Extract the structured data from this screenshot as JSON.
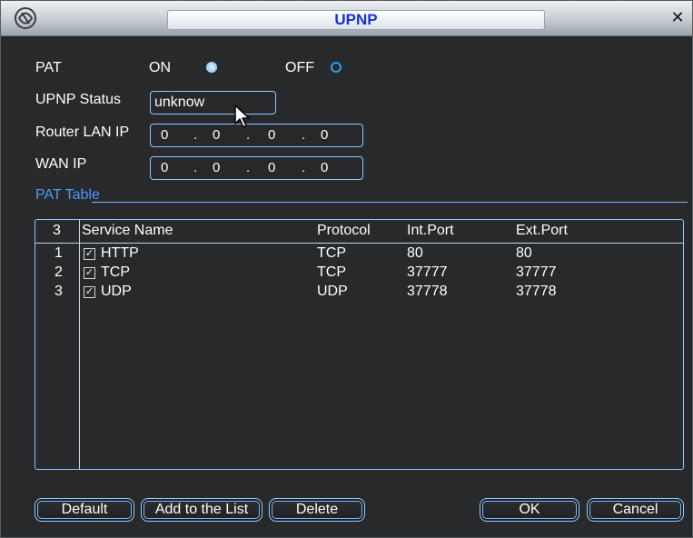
{
  "window": {
    "title": "UPNP",
    "close_label": "✕"
  },
  "form": {
    "pat_label": "PAT",
    "on_label": "ON",
    "off_label": "OFF",
    "pat_selected": "ON",
    "upnp_status_label": "UPNP Status",
    "upnp_status_value": "unknow",
    "router_lan_ip_label": "Router LAN IP",
    "router_lan_ip": [
      "0",
      "0",
      "0",
      "0"
    ],
    "wan_ip_label": "WAN IP",
    "wan_ip": [
      "0",
      "0",
      "0",
      "0"
    ],
    "ip_separator": "."
  },
  "pat_table": {
    "label": "PAT Table",
    "count": "3",
    "columns": [
      "Service Name",
      "Protocol",
      "Int.Port",
      "Ext.Port"
    ],
    "rows": [
      {
        "index": "1",
        "checked": true,
        "service": "HTTP",
        "protocol": "TCP",
        "int_port": "80",
        "ext_port": "80"
      },
      {
        "index": "2",
        "checked": true,
        "service": "TCP",
        "protocol": "TCP",
        "int_port": "37777",
        "ext_port": "37777"
      },
      {
        "index": "3",
        "checked": true,
        "service": "UDP",
        "protocol": "UDP",
        "int_port": "37778",
        "ext_port": "37778"
      }
    ]
  },
  "buttons": {
    "default": "Default",
    "add_to_list": "Add to the List",
    "delete": "Delete",
    "ok": "OK",
    "cancel": "Cancel"
  },
  "colors": {
    "accent": "#2ea0f4",
    "title_text": "#1631d8",
    "section_label": "#4c9bff",
    "background": "#27292b"
  }
}
